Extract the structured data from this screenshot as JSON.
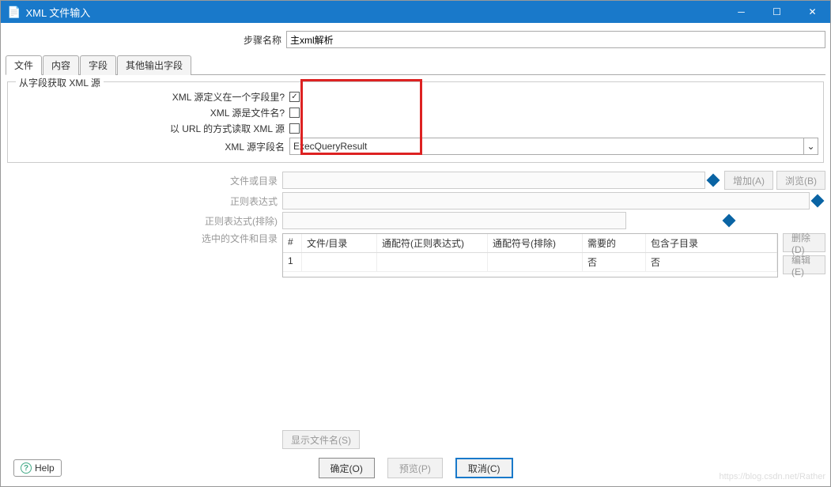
{
  "titlebar": {
    "title": "XML 文件输入"
  },
  "stepname": {
    "label": "步骤名称",
    "value": "主xml解析"
  },
  "tabs": [
    "文件",
    "内容",
    "字段",
    "其他输出字段"
  ],
  "group": {
    "title": "从字段获取 XML 源",
    "row1": "XML 源定义在一个字段里?",
    "row2": "XML 源是文件名?",
    "row3": "以 URL 的方式读取 XML 源",
    "row4": "XML 源字段名",
    "combo_value": "ExecQueryResult"
  },
  "file": {
    "file_or_dir": "文件或目录",
    "regex": "正则表达式",
    "regex_excl": "正则表达式(排除)",
    "selected": "选中的文件和目录",
    "add_btn": "增加(A)",
    "browse_btn": "浏览(B)",
    "delete_btn": "删除(D)",
    "edit_btn": "编辑(E)",
    "showfn_btn": "显示文件名(S)"
  },
  "table": {
    "cols": [
      "#",
      "文件/目录",
      "通配符(正则表达式)",
      "通配符号(排除)",
      "需要的",
      "包含子目录"
    ],
    "subcols": [
      "否",
      "否"
    ],
    "row_num": "1"
  },
  "footer": {
    "help": "Help",
    "ok": "确定(O)",
    "preview": "预览(P)",
    "cancel": "取消(C)"
  },
  "watermark": "https://blog.csdn.net/Rather"
}
